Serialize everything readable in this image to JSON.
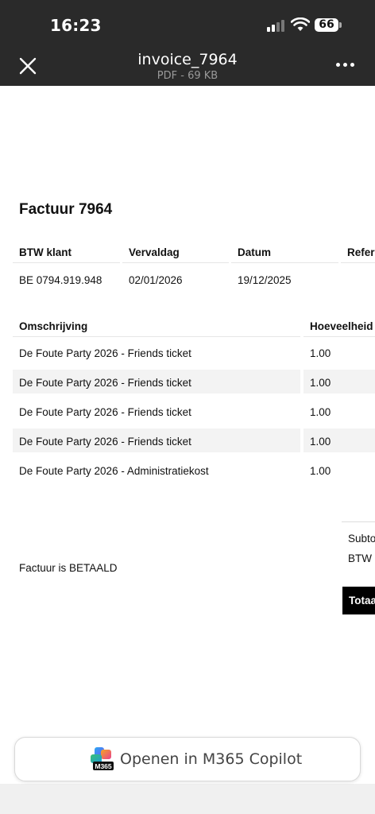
{
  "status_bar": {
    "time": "16:23",
    "battery": "66"
  },
  "header": {
    "title": "invoice_7964",
    "subtitle": "PDF - 69 KB"
  },
  "invoice": {
    "title": "Factuur 7964",
    "meta_headers": [
      "BTW klant",
      "Vervaldag",
      "Datum",
      "Refer"
    ],
    "meta_values": [
      "BE 0794.919.948",
      "02/01/2026",
      "19/12/2025"
    ],
    "columns": [
      "Omschrijving",
      "Hoeveelheid"
    ],
    "lines": [
      {
        "description": "De Foute Party 2026 - Friends ticket",
        "quantity": "1.00"
      },
      {
        "description": "De Foute Party 2026 - Friends ticket",
        "quantity": "1.00"
      },
      {
        "description": "De Foute Party 2026 - Friends ticket",
        "quantity": "1.00"
      },
      {
        "description": "De Foute Party 2026 - Friends ticket",
        "quantity": "1.00"
      },
      {
        "description": "De Foute Party 2026 - Administratiekost",
        "quantity": "1.00"
      }
    ],
    "status": "Factuur is BETAALD",
    "summary": {
      "subtotal": "Subto",
      "vat": "BTW (",
      "total": "Totaa"
    }
  },
  "copilot": {
    "label": "Openen in M365 Copilot",
    "badge": "M365"
  },
  "colors": {
    "topbar": "#2a2a2a",
    "stripe": "#f3f3f3",
    "total_bg": "#000000"
  }
}
